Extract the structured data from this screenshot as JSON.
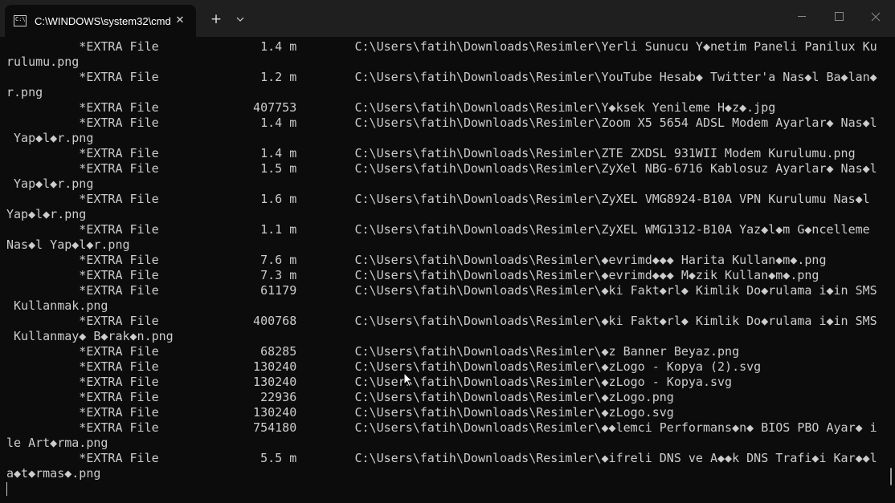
{
  "window": {
    "tab_title": "C:\\WINDOWS\\system32\\cmd.",
    "tab_icon_text": "C:\\",
    "close_tab_glyph": "✕",
    "new_tab_glyph": "+"
  },
  "console": {
    "lines": [
      "          *EXTRA File              1.4 m        C:\\Users\\fatih\\Downloads\\Resimler\\Yerli Sunucu Y◆netim Paneli Panilux Ku",
      "rulumu.png",
      "          *EXTRA File              1.2 m        C:\\Users\\fatih\\Downloads\\Resimler\\YouTube Hesab◆ Twitter'a Nas◆l Ba◆lan◆",
      "r.png",
      "          *EXTRA File             407753        C:\\Users\\fatih\\Downloads\\Resimler\\Y◆ksek Yenileme H◆z◆.jpg",
      "          *EXTRA File              1.4 m        C:\\Users\\fatih\\Downloads\\Resimler\\Zoom X5 5654 ADSL Modem Ayarlar◆ Nas◆l",
      " Yap◆l◆r.png",
      "          *EXTRA File              1.4 m        C:\\Users\\fatih\\Downloads\\Resimler\\ZTE ZXDSL 931WII Modem Kurulumu.png",
      "          *EXTRA File              1.5 m        C:\\Users\\fatih\\Downloads\\Resimler\\ZyXel NBG-6716 Kablosuz Ayarlar◆ Nas◆l",
      " Yap◆l◆r.png",
      "          *EXTRA File              1.6 m        C:\\Users\\fatih\\Downloads\\Resimler\\ZyXEL VMG8924-B10A VPN Kurulumu Nas◆l",
      "Yap◆l◆r.png",
      "          *EXTRA File              1.1 m        C:\\Users\\fatih\\Downloads\\Resimler\\ZyXEL WMG1312-B10A Yaz◆l◆m G◆ncelleme",
      "Nas◆l Yap◆l◆r.png",
      "          *EXTRA File              7.6 m        C:\\Users\\fatih\\Downloads\\Resimler\\◆evrimd◆◆◆ Harita Kullan◆m◆.png",
      "          *EXTRA File              7.3 m        C:\\Users\\fatih\\Downloads\\Resimler\\◆evrimd◆◆◆ M◆zik Kullan◆m◆.png",
      "          *EXTRA File              61179        C:\\Users\\fatih\\Downloads\\Resimler\\◆ki Fakt◆rl◆ Kimlik Do◆rulama i◆in SMS",
      " Kullanmak.png",
      "          *EXTRA File             400768        C:\\Users\\fatih\\Downloads\\Resimler\\◆ki Fakt◆rl◆ Kimlik Do◆rulama i◆in SMS",
      " Kullanmay◆ B◆rak◆n.png",
      "          *EXTRA File              68285        C:\\Users\\fatih\\Downloads\\Resimler\\◆z Banner Beyaz.png",
      "          *EXTRA File             130240        C:\\Users\\fatih\\Downloads\\Resimler\\◆zLogo - Kopya (2).svg",
      "          *EXTRA File             130240        C:\\Users\\fatih\\Downloads\\Resimler\\◆zLogo - Kopya.svg",
      "          *EXTRA File              22936        C:\\Users\\fatih\\Downloads\\Resimler\\◆zLogo.png",
      "          *EXTRA File             130240        C:\\Users\\fatih\\Downloads\\Resimler\\◆zLogo.svg",
      "          *EXTRA File             754180        C:\\Users\\fatih\\Downloads\\Resimler\\◆◆lemci Performans◆n◆ BIOS PBO Ayar◆ i",
      "le Art◆rma.png",
      "          *EXTRA File              5.5 m        C:\\Users\\fatih\\Downloads\\Resimler\\◆ifreli DNS ve A◆◆k DNS Trafi◆i Kar◆◆l",
      "a◆t◆rmas◆.png"
    ]
  },
  "icons": {
    "tab": "cmd-icon",
    "close": "close-icon",
    "add": "plus-icon",
    "dropdown": "chevron-down-icon"
  },
  "colors": {
    "background": "#0c0c0c",
    "tabbar": "#1f1f1f",
    "text": "#cccccc"
  }
}
